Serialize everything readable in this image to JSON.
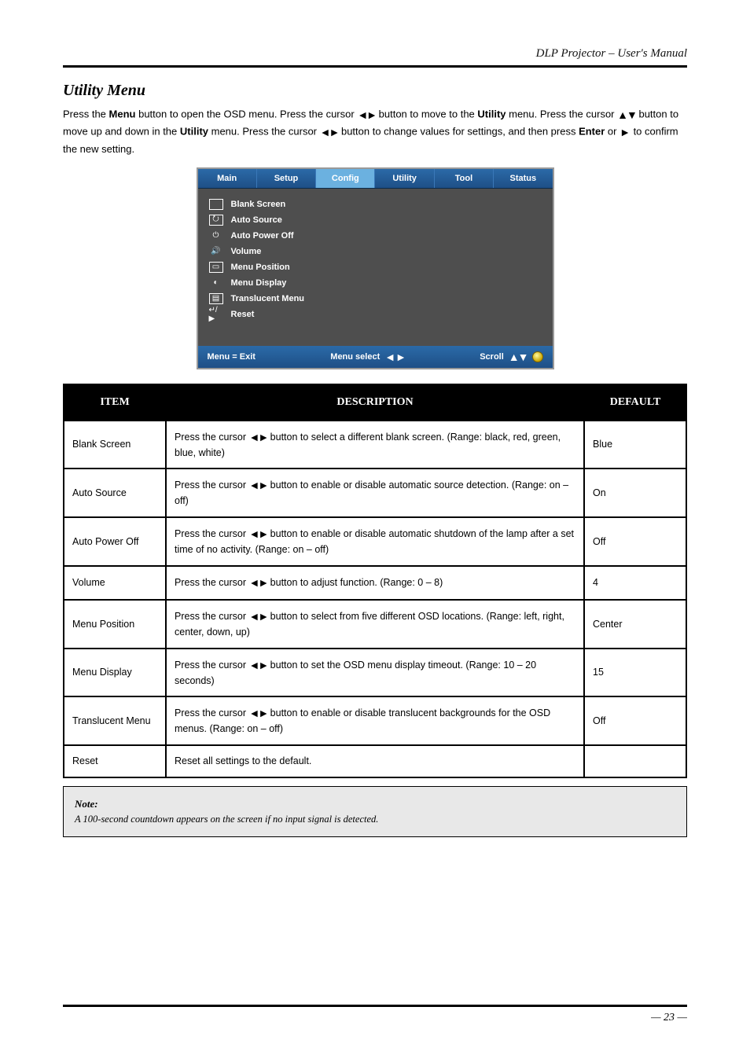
{
  "header": {
    "right": "DLP Projector – User's Manual"
  },
  "section_title": "Utility Menu",
  "intro": {
    "line1_a": "Press the ",
    "menu_bold": "Menu",
    "line1_b": " button to open the OSD menu. Press the cursor ",
    "line1_c": " button to move to the ",
    "utility_bold": "Utility",
    "line1_d": " menu. Press the cursor ",
    "line1_e": " button to move up and down in the ",
    "line1_f": " menu. Press the cursor ",
    "line1_g": " button to change values for settings, and then press ",
    "enter_bold": "Enter",
    "or_text": " or ",
    "line1_h": " to confirm the new setting."
  },
  "osd": {
    "tabs": [
      "Main",
      "Setup",
      "Config",
      "Utility",
      "Tool",
      "Status"
    ],
    "active_tab_index": 2,
    "items": [
      "Blank Screen",
      "Auto Source",
      "Auto Power Off",
      "Volume",
      "Menu Position",
      "Menu Display",
      "Translucent Menu",
      "Reset"
    ],
    "footer": {
      "exit": "Menu = Exit",
      "select": "Menu select",
      "scroll": "Scroll"
    }
  },
  "table": {
    "headers": [
      "ITEM",
      "DESCRIPTION",
      "DEFAULT"
    ],
    "rows": [
      {
        "item": "Blank Screen",
        "desc_a": "Press the cursor ",
        "desc_b": " button to select a different blank screen. (Range: black, red, green, blue, white)",
        "def": "Blue"
      },
      {
        "item": "Auto Source",
        "desc_a": "Press the cursor ",
        "desc_b": " button to enable or disable automatic source detection. (Range: on – off)",
        "def": "On"
      },
      {
        "item": "Auto Power Off",
        "desc_a": "Press the cursor ",
        "desc_b": " button to enable or disable automatic shutdown of the lamp after a set time of no activity. (Range: on – off)",
        "def": "Off"
      },
      {
        "item": "Volume",
        "desc_a": "Press the cursor ",
        "desc_b": " button to adjust function. (Range: 0 – 8)",
        "def": "4"
      },
      {
        "item": "Menu Position",
        "desc_a": "Press the cursor ",
        "desc_b": " button to select from five different OSD locations. (Range: left, right, center, down, up)",
        "def": "Center"
      },
      {
        "item": "Menu Display",
        "desc_a": "Press the cursor ",
        "desc_b": " button to set the OSD menu display timeout. (Range: 10 – 20 seconds)",
        "def": "15"
      },
      {
        "item": "Translucent Menu",
        "desc_a": "Press the cursor ",
        "desc_b": " button to enable or disable translucent backgrounds for the OSD menus. (Range: on – off)",
        "def": "Off"
      },
      {
        "item": "Reset",
        "desc_plain": "Reset all settings to the default.",
        "def": ""
      }
    ]
  },
  "note": {
    "title": "Note:",
    "body": "A 100-second countdown appears on the screen if no input signal is detected."
  },
  "footer": {
    "left": "",
    "right": "— 23 —"
  }
}
